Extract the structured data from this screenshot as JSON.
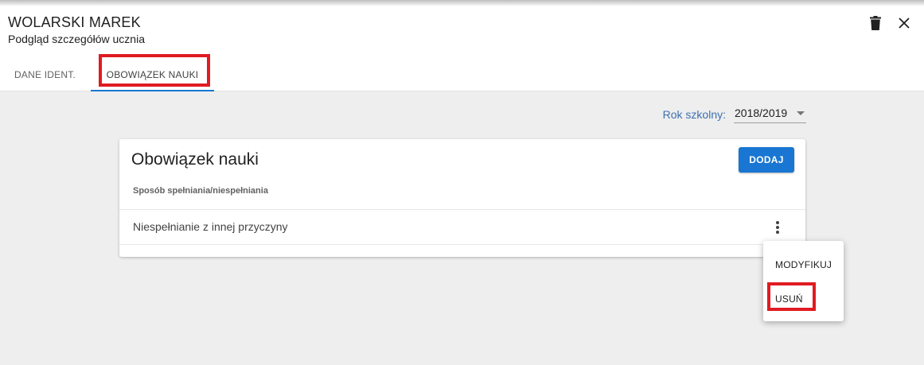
{
  "header": {
    "title": "WOLARSKI MAREK",
    "subtitle": "Podgląd szczegółów ucznia",
    "delete_icon": "trash-icon",
    "close_icon": "close-icon"
  },
  "tabs": [
    {
      "label": "DANE IDENT.",
      "active": false
    },
    {
      "label": "OBOWIĄZEK NAUKI",
      "active": true
    }
  ],
  "school_year": {
    "label": "Rok szkolny:",
    "value": "2018/2019"
  },
  "card": {
    "title": "Obowiązek nauki",
    "add_label": "DODAJ",
    "column_header": "Sposób spełniania/niespełniania",
    "rows": [
      {
        "text": "Niespełnianie z innej przyczyny"
      }
    ]
  },
  "context_menu": {
    "items": [
      {
        "label": "MODYFIKUJ"
      },
      {
        "label": "USUŃ"
      }
    ]
  },
  "colors": {
    "accent": "#1976d2",
    "highlight": "#e01b22",
    "label_blue": "#3d6fb0"
  }
}
